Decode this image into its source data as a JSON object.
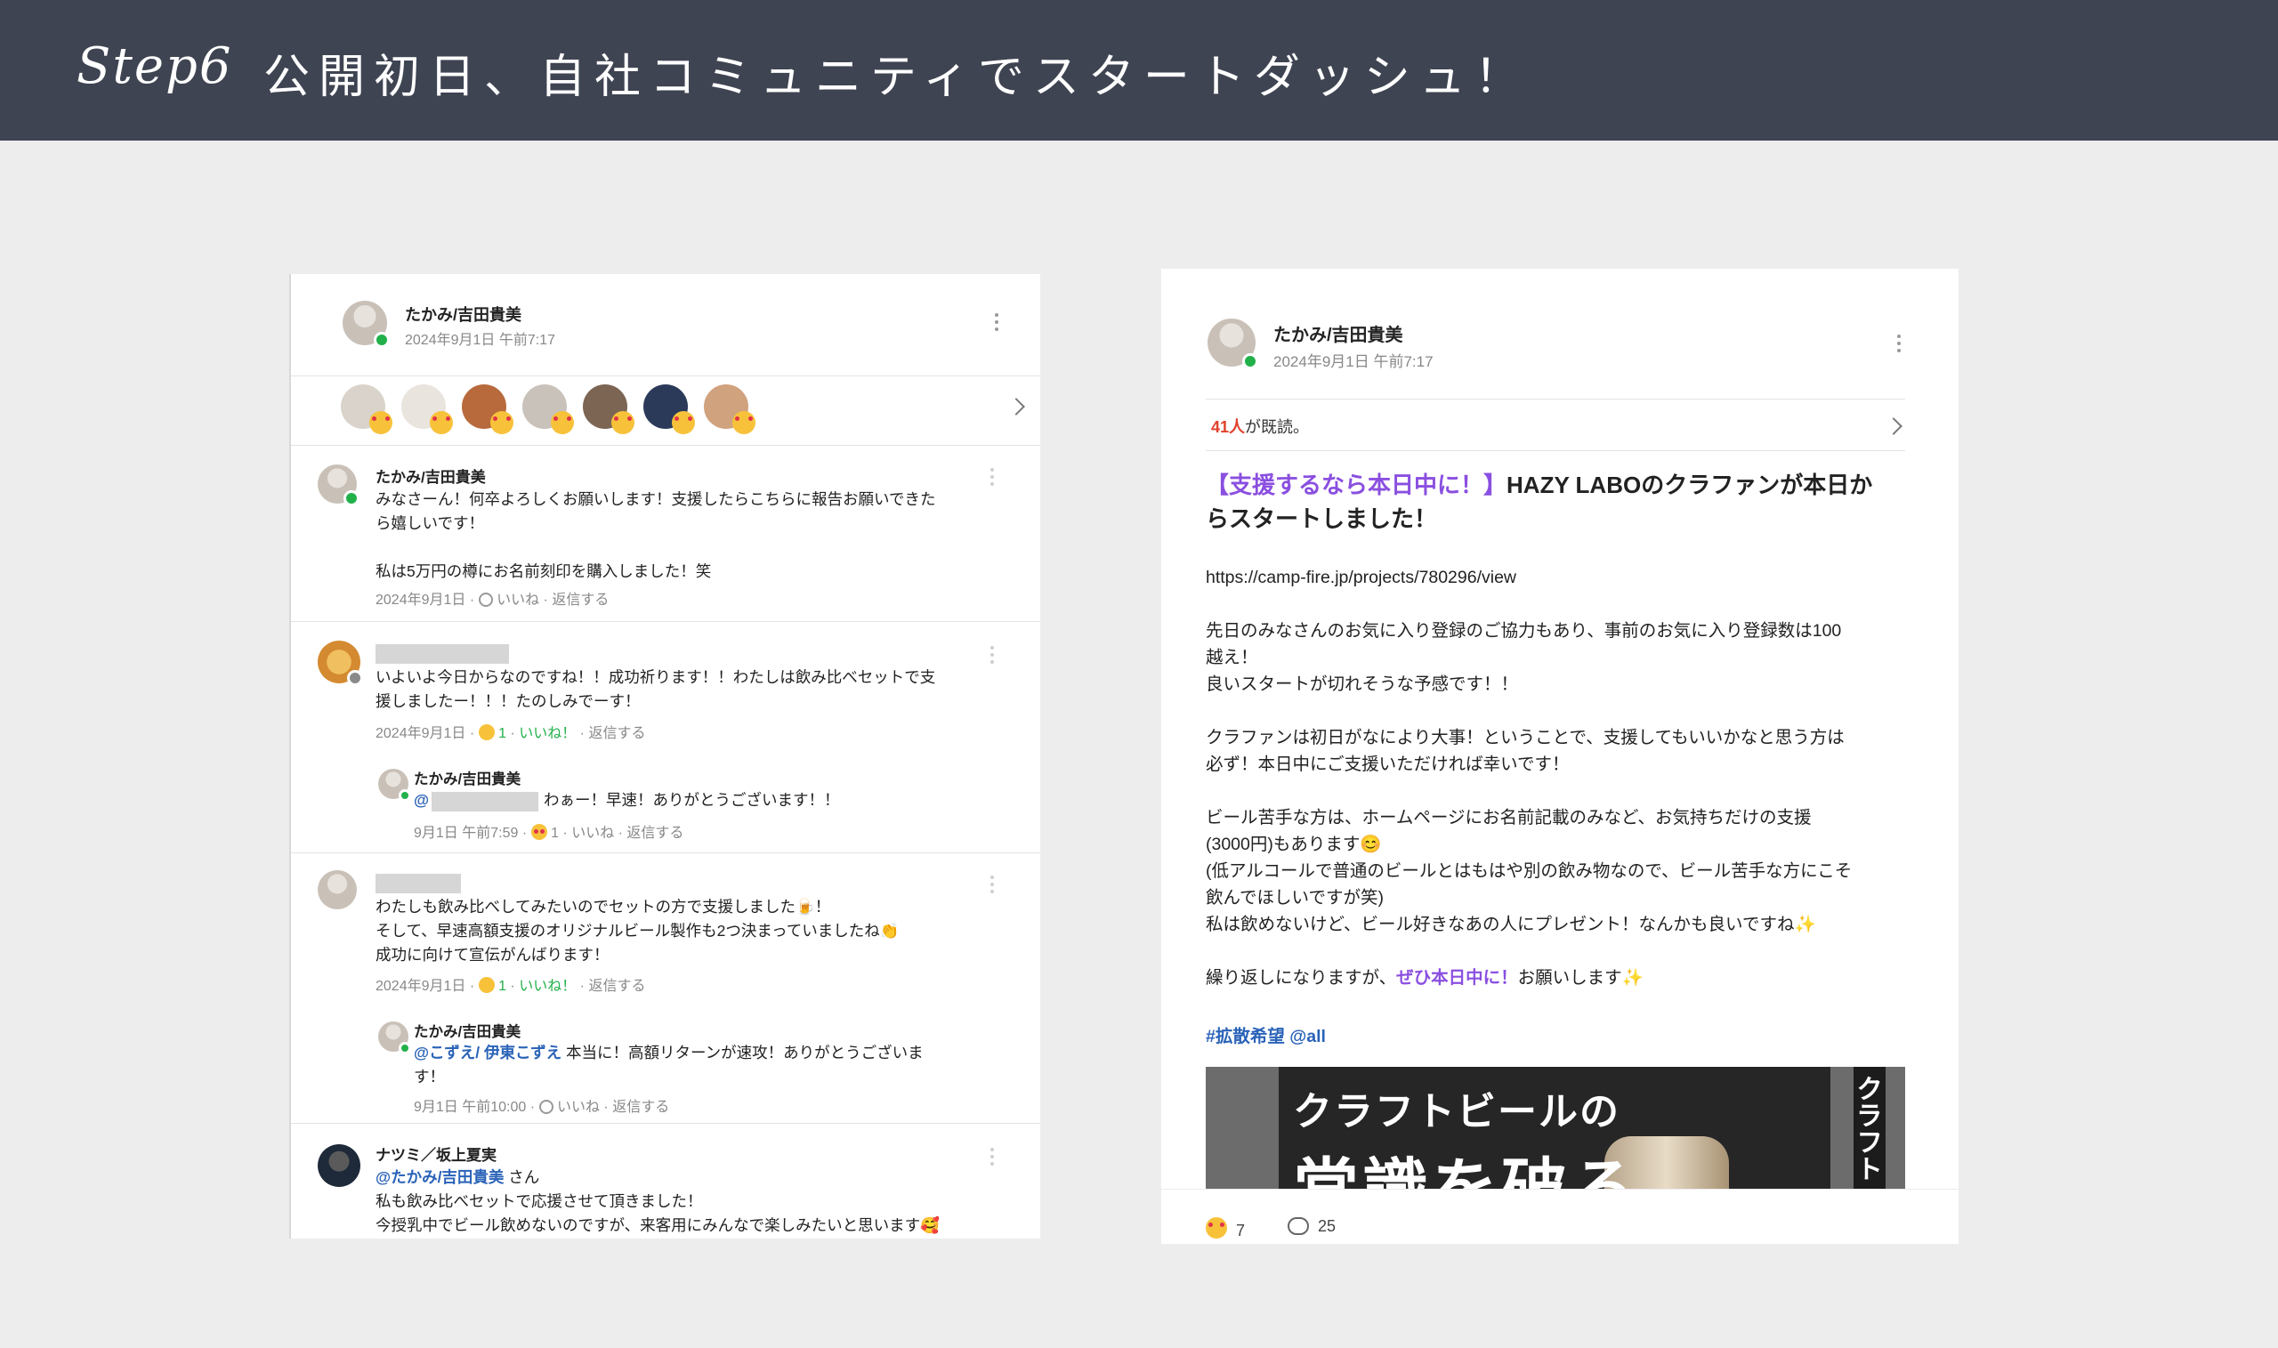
{
  "banner": {
    "step": "Step6",
    "title": "公開初日、自社コミュニティでスタートダッシュ！"
  },
  "left": {
    "post": {
      "author": "たかみ/吉田貴美",
      "date": "2024年9月1日 午前7:17"
    },
    "comments": [
      {
        "author": "たかみ/吉田貴美",
        "lines": [
          "みなさーん！何卒よろしくお願いします！支援したらこちらに報告お願いできた",
          "ら嬉しいです！",
          "",
          "私は5万円の樽にお名前刻印を購入しました！笑"
        ],
        "date": "2024年9月1日",
        "like": "いいね",
        "reply": "返信する"
      },
      {
        "lines": [
          "いよいよ今日からなのですね！！成功祈ります！！わたしは飲み比べセットで支",
          "援しましたー！！！たのしみでーす！"
        ],
        "date": "2024年9月1日",
        "count": "1",
        "like": "いいね！",
        "reply": "返信する",
        "reply_item": {
          "author": "たかみ/吉田貴美",
          "at": "@",
          "text": "わぁー！早速！ありがとうございます！！",
          "date": "9月1日 午前7:59",
          "count": "1",
          "like": "いいね",
          "reply": "返信する"
        }
      },
      {
        "lines": [
          "わたしも飲み比べしてみたいのでセットの方で支援しました🍺！",
          "そして、早速高額支援のオリジナルビール製作も2つ決まっていましたね👏",
          "成功に向けて宣伝がんばります！"
        ],
        "date": "2024年9月1日",
        "count": "1",
        "like": "いいね！",
        "reply": "返信する",
        "reply_item": {
          "author": "たかみ/吉田貴美",
          "mention": "@こずえ/ 伊東こずえ",
          "line1": " 本当に！高額リターンが速攻！ありがとうございま",
          "line2": "す！",
          "date": "9月1日 午前10:00",
          "like": "いいね",
          "reply": "返信する"
        }
      },
      {
        "author": "ナツミ／坂上夏実",
        "mention": "@たかみ/吉田貴美",
        "suffix": " さん",
        "lines": [
          "私も飲み比べセットで応援させて頂きました！",
          "今授乳中でビール飲めないのですが、来客用にみんなで楽しみたいと思います🥰"
        ]
      }
    ]
  },
  "right": {
    "author": "たかみ/吉田貴美",
    "date": "2024年9月1日 午前7:17",
    "read_count": "41人",
    "read_suffix": "が既読。",
    "title_highlight": "【支援するなら本日中に！】",
    "title_line1_rest": "HAZY LABOのクラファンが本日か",
    "title_line2": "らスタートしました！",
    "url": "https://camp-fire.jp/projects/780296/view",
    "p1": [
      "先日のみなさんのお気に入り登録のご協力もあり、事前のお気に入り登録数は100",
      "越え！",
      "良いスタートが切れそうな予感です！！"
    ],
    "p2": [
      "クラファンは初日がなにより大事！ということで、支援してもいいかなと思う方は",
      "必ず！本日中にご支援いただければ幸いです！"
    ],
    "p3": [
      "ビール苦手な方は、ホームページにお名前記載のみなど、お気持ちだけの支援",
      "(3000円)もあります😊",
      "(低アルコールで普通のビールとはもはや別の飲み物なので、ビール苦手な方にこそ",
      "飲んでほしいですが笑)",
      "私は飲めないけど、ビール好きなあの人にプレゼント！なんかも良いですね✨"
    ],
    "p4_pre": "繰り返しになりますが、",
    "p4_highlight": "ぜひ本日中に！",
    "p4_post": "お願いします✨",
    "hashtags": "#拡散希望 @all",
    "promo_line1": "クラフトビールの",
    "promo_line2": "常識を破る",
    "promo_side": "クラフト",
    "reaction_count": "7",
    "comment_count": "25"
  }
}
